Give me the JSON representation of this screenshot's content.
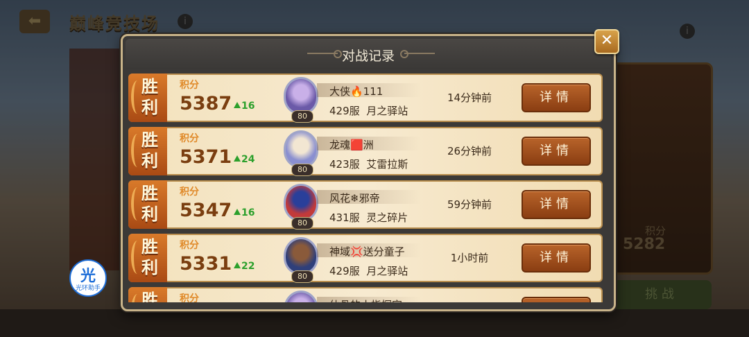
{
  "background": {
    "arena_title": "巅峰竞技场",
    "right_score_label": "积分",
    "right_score": "5282",
    "right_button": "挑 战"
  },
  "modal": {
    "title": "对战记录",
    "close_glyph": "✕",
    "score_label": "积分",
    "detail_label": "详情",
    "records": [
      {
        "result": "胜利",
        "score": "5387",
        "delta": "16",
        "name": "大侠🔥111",
        "level": "80",
        "server": "429服",
        "zone": "月之驿站",
        "time": "14分钟前",
        "avatar_colors": [
          "#6b5aa8",
          "#c9b0e8"
        ]
      },
      {
        "result": "胜利",
        "score": "5371",
        "delta": "24",
        "name": "龙魂🟥洲",
        "level": "80",
        "server": "423服",
        "zone": "艾雷拉斯",
        "time": "26分钟前",
        "avatar_colors": [
          "#8a8fd0",
          "#f2e6d2"
        ]
      },
      {
        "result": "胜利",
        "score": "5347",
        "delta": "16",
        "name": "风花❄邪帝",
        "level": "80",
        "server": "431服",
        "zone": "灵之碎片",
        "time": "59分钟前",
        "avatar_colors": [
          "#c23a3a",
          "#2a3f9a"
        ]
      },
      {
        "result": "胜利",
        "score": "5331",
        "delta": "22",
        "name": "神域💢送分童子",
        "level": "80",
        "server": "429服",
        "zone": "月之驿站",
        "time": "1小时前",
        "avatar_colors": [
          "#2f3f7a",
          "#8a5a3a"
        ]
      },
      {
        "result": "胜利",
        "score": "",
        "delta": "",
        "name": "仙骨的小指探宫",
        "level": "",
        "server": "",
        "zone": "",
        "time": "",
        "avatar_colors": [
          "#6b5aa8",
          "#c9b0e8"
        ]
      }
    ]
  },
  "helper": {
    "char": "光",
    "label": "光环助手"
  }
}
